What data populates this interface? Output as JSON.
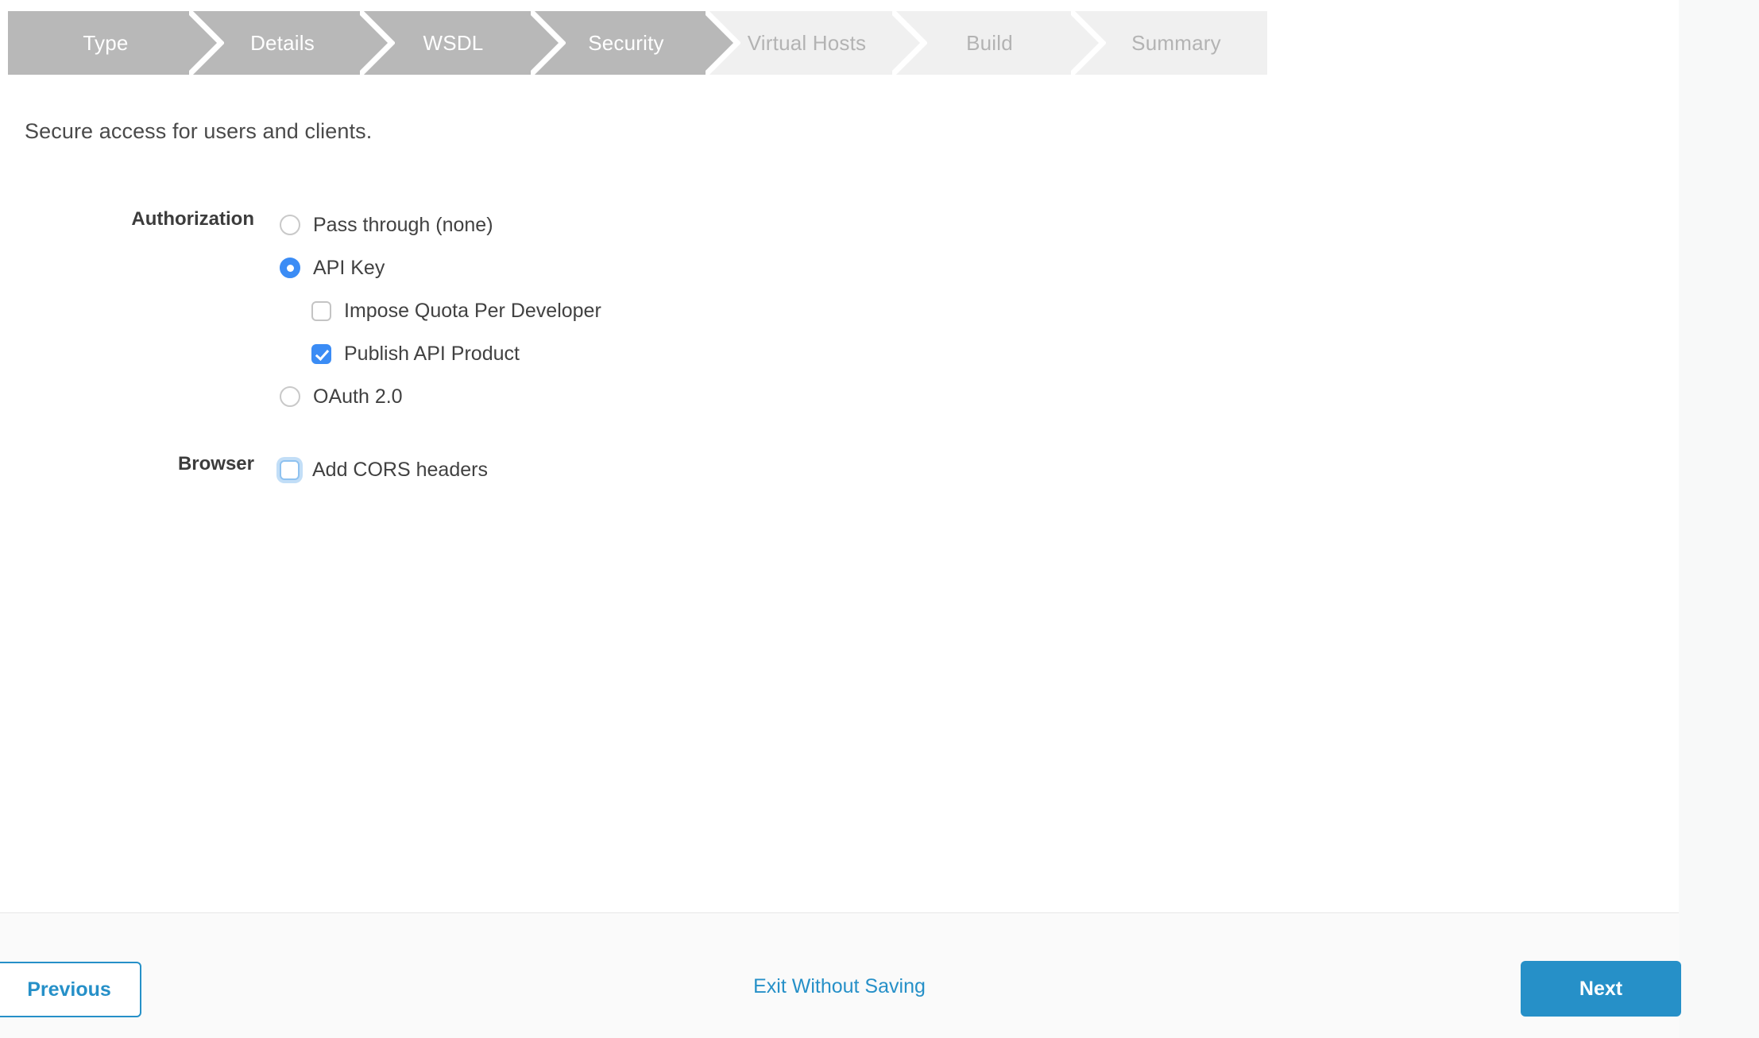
{
  "wizard": {
    "steps": [
      {
        "label": "Type",
        "state": "done"
      },
      {
        "label": "Details",
        "state": "done"
      },
      {
        "label": "WSDL",
        "state": "done"
      },
      {
        "label": "Security",
        "state": "active"
      },
      {
        "label": "Virtual Hosts",
        "state": "todo"
      },
      {
        "label": "Build",
        "state": "todo"
      },
      {
        "label": "Summary",
        "state": "todo"
      }
    ]
  },
  "page": {
    "intro": "Secure access for users and clients."
  },
  "form": {
    "authorization": {
      "label": "Authorization",
      "options": [
        {
          "label": "Pass through (none)",
          "type": "radio",
          "checked": false,
          "indent": false
        },
        {
          "label": "API Key",
          "type": "radio",
          "checked": true,
          "indent": false
        },
        {
          "label": "Impose Quota Per Developer",
          "type": "checkbox",
          "checked": false,
          "indent": true
        },
        {
          "label": "Publish API Product",
          "type": "checkbox",
          "checked": true,
          "indent": true
        },
        {
          "label": "OAuth 2.0",
          "type": "radio",
          "checked": false,
          "indent": false
        }
      ]
    },
    "browser": {
      "label": "Browser",
      "options": [
        {
          "label": "Add CORS headers",
          "type": "checkbox",
          "checked": false,
          "focused": true,
          "indent": false
        }
      ]
    }
  },
  "footer": {
    "previous_label": "Previous",
    "exit_label": "Exit Without Saving",
    "next_label": "Next"
  },
  "colors": {
    "accent_blue": "#2690c8",
    "control_blue": "#3b8cf5",
    "step_active": "#b8b8b8",
    "step_todo": "#f0f0f0",
    "step_todo_text": "#b3b3b3",
    "panel_bg": "#ffffff",
    "outer_bg": "#f8f9f9",
    "footer_bg": "#fafafa"
  }
}
